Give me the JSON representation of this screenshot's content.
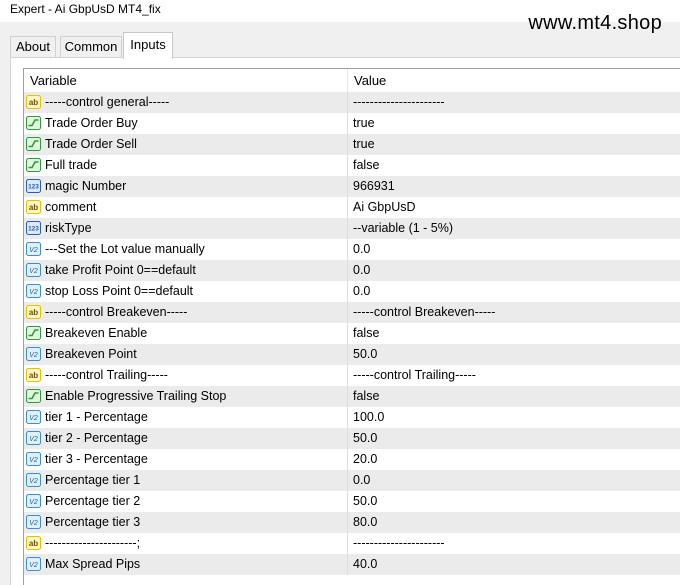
{
  "window": {
    "title": "Expert - Ai GbpUsD MT4_fix",
    "watermark": "www.mt4.shop"
  },
  "tabs": [
    {
      "label": "About",
      "active": false
    },
    {
      "label": "Common",
      "active": false
    },
    {
      "label": "Inputs",
      "active": true
    }
  ],
  "grid": {
    "headers": {
      "variable": "Variable",
      "value": "Value"
    },
    "rows": [
      {
        "icon": "ab-string-icon",
        "name": "-----control general-----",
        "value": "----------------------"
      },
      {
        "icon": "bool-icon",
        "name": "Trade Order Buy",
        "value": "true"
      },
      {
        "icon": "bool-icon",
        "name": "Trade Order Sell",
        "value": "true"
      },
      {
        "icon": "bool-icon",
        "name": "Full trade",
        "value": "false"
      },
      {
        "icon": "int-123-icon",
        "name": "magic Number",
        "value": "966931"
      },
      {
        "icon": "ab-string-icon",
        "name": "comment",
        "value": "Ai GbpUsD"
      },
      {
        "icon": "int-123-icon",
        "name": "riskType",
        "value": "--variable (1 - 5%)"
      },
      {
        "icon": "double-v2-icon",
        "name": "---Set the Lot value manually",
        "value": "0.0"
      },
      {
        "icon": "double-v2-icon",
        "name": "take Profit Point 0==default",
        "value": "0.0"
      },
      {
        "icon": "double-v2-icon",
        "name": "stop Loss Point  0==default",
        "value": "0.0"
      },
      {
        "icon": "ab-string-icon",
        "name": "-----control Breakeven-----",
        "value": "-----control Breakeven-----"
      },
      {
        "icon": "bool-icon",
        "name": "Breakeven Enable",
        "value": "false"
      },
      {
        "icon": "double-v2-icon",
        "name": "Breakeven Point",
        "value": "50.0"
      },
      {
        "icon": "ab-string-icon",
        "name": "-----control Trailing-----",
        "value": "-----control Trailing-----"
      },
      {
        "icon": "bool-icon",
        "name": "Enable Progressive Trailing Stop",
        "value": "false"
      },
      {
        "icon": "double-v2-icon",
        "name": "tier 1 - Percentage",
        "value": "100.0"
      },
      {
        "icon": "double-v2-icon",
        "name": "tier 2 - Percentage",
        "value": "50.0"
      },
      {
        "icon": "double-v2-icon",
        "name": "tier 3 - Percentage",
        "value": "20.0"
      },
      {
        "icon": "double-v2-icon",
        "name": "Percentage tier 1",
        "value": "0.0"
      },
      {
        "icon": "double-v2-icon",
        "name": "Percentage tier 2",
        "value": "50.0"
      },
      {
        "icon": "double-v2-icon",
        "name": "Percentage tier 3",
        "value": "80.0"
      },
      {
        "icon": "ab-string-icon",
        "name": "----------------------;",
        "value": "----------------------"
      },
      {
        "icon": "double-v2-icon",
        "name": "Max Spread Pips",
        "value": "40.0"
      }
    ]
  },
  "colors": {
    "ab_icon": "#e8c000",
    "bool_icon": "#2f9a3a",
    "int_icon": "#2a5db0",
    "double_icon": "#3a8fd0"
  }
}
